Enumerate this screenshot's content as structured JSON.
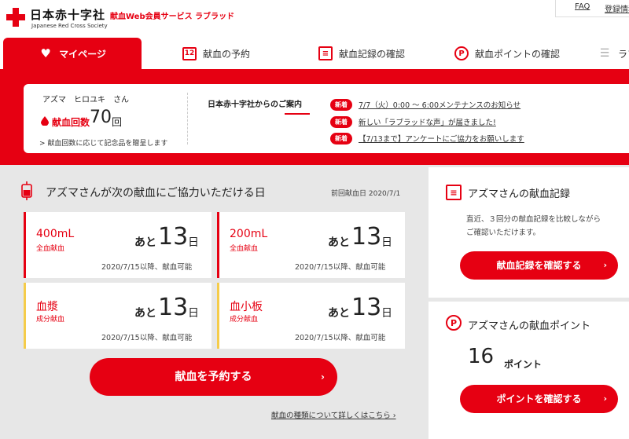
{
  "header": {
    "logo_jp": "日本赤十字社",
    "logo_en": "Japanese Red Cross Society",
    "service_name": "献血Web会員サービス ラブラッド",
    "faq": "FAQ",
    "register": "登録情報"
  },
  "nav": {
    "tabs": [
      {
        "label": "マイページ",
        "icon": "heart-icon",
        "active": true
      },
      {
        "label": "献血の予約",
        "icon": "calendar-icon",
        "icon_text": "12"
      },
      {
        "label": "献血記録の確認",
        "icon": "list-icon",
        "icon_text": "≡"
      },
      {
        "label": "献血ポイントの確認",
        "icon": "point-icon",
        "icon_text": "P"
      },
      {
        "label": "ラブ",
        "icon": "menu-icon",
        "icon_text": "☰"
      }
    ]
  },
  "user": {
    "name": "アズマ　ヒロユキ　さん",
    "count_label": "献血回数",
    "count": "70",
    "count_unit": "回",
    "gift_link": "> 献血回数に応じて記念品を贈呈します"
  },
  "notices": {
    "title": "日本赤十字社からのご案内",
    "badge": "新着",
    "items": [
      "7/7（火）0:00 ～ 6:00メンテナンスのお知らせ",
      "新しい「ラブラッドな声」が届きました!",
      "【7/13まで】アンケートにご協力をお願いします"
    ]
  },
  "donation": {
    "title": "アズマさんが次の献血にご協力いただける日",
    "last_date": "前回献血日 2020/7/1",
    "cards": [
      {
        "name": "400mL",
        "sub": "全血献血",
        "label": "あと",
        "days": "13",
        "unit": "日",
        "available": "2020/7/15以降、献血可能",
        "accent": "#e60012"
      },
      {
        "name": "200mL",
        "sub": "全血献血",
        "label": "あと",
        "days": "13",
        "unit": "日",
        "available": "2020/7/15以降、献血可能",
        "accent": "#e60012"
      },
      {
        "name": "血漿",
        "sub": "成分献血",
        "label": "あと",
        "days": "13",
        "unit": "日",
        "available": "2020/7/15以降、献血可能",
        "accent": "#f5cc4a"
      },
      {
        "name": "血小板",
        "sub": "成分献血",
        "label": "あと",
        "days": "13",
        "unit": "日",
        "available": "2020/7/15以降、献血可能",
        "accent": "#f5cc4a"
      }
    ],
    "reserve_button": "献血を予約する",
    "detail_link": "献血の種類について詳しくはこちら ›"
  },
  "record": {
    "title": "アズマさんの献血記録",
    "desc_line1": "直近、３回分の献血記録を比較しながら",
    "desc_line2": "ご確認いただけます。",
    "button": "献血記録を確認する"
  },
  "points": {
    "title": "アズマさんの献血ポイント",
    "value": "16",
    "unit": "ポイント",
    "button": "ポイントを確認する"
  },
  "colors": {
    "brand": "#e60012",
    "component_accent": "#f5cc4a",
    "background": "#e7e7e7"
  },
  "arrow": "›"
}
